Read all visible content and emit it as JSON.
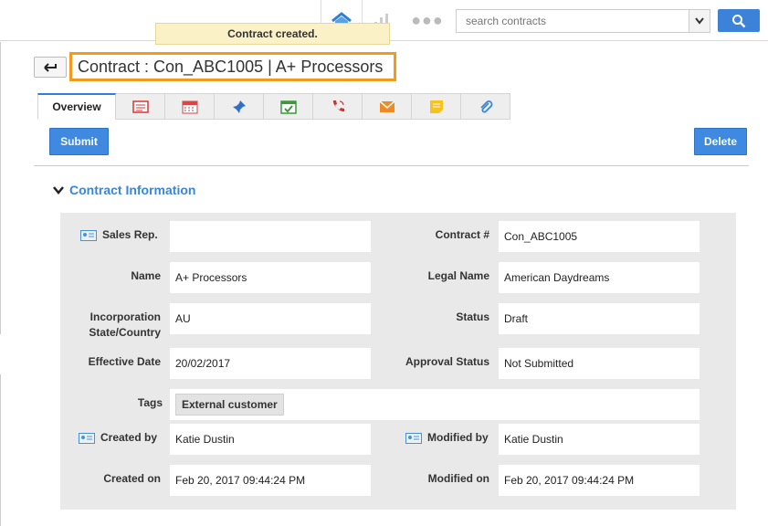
{
  "toast": {
    "message": "Contract created."
  },
  "search": {
    "placeholder": "search contracts"
  },
  "header": {
    "title": "Contract : Con_ABC1005 | A+ Processors"
  },
  "tabs": {
    "overview_label": "Overview"
  },
  "actions": {
    "submit_label": "Submit",
    "delete_label": "Delete"
  },
  "section": {
    "title": "Contract Information"
  },
  "fields": {
    "sales_rep": {
      "label": "Sales Rep.",
      "value": ""
    },
    "contract_no": {
      "label": "Contract #",
      "value": "Con_ABC1005"
    },
    "name": {
      "label": "Name",
      "value": "A+ Processors"
    },
    "legal_name": {
      "label": "Legal Name",
      "value": "American Daydreams"
    },
    "incorporation": {
      "label_line1": "Incorporation",
      "label_line2": "State/Country",
      "value": "AU"
    },
    "status": {
      "label": "Status",
      "value": "Draft"
    },
    "effective_date": {
      "label": "Effective Date",
      "value": "20/02/2017"
    },
    "approval_status": {
      "label": "Approval Status",
      "value": "Not Submitted"
    },
    "tags": {
      "label": "Tags",
      "chips": [
        "External customer"
      ]
    },
    "created_by": {
      "label": "Created by",
      "value": "Katie Dustin"
    },
    "modified_by": {
      "label": "Modified by",
      "value": "Katie Dustin"
    },
    "created_on": {
      "label": "Created on",
      "value": "Feb 20, 2017 09:44:24 PM"
    },
    "modified_on": {
      "label": "Modified on",
      "value": "Feb 20, 2017 09:44:24 PM"
    }
  },
  "colors": {
    "accent": "#3f8ae0",
    "highlight": "#f39a1e",
    "toast_bg": "#fbf1c7"
  }
}
